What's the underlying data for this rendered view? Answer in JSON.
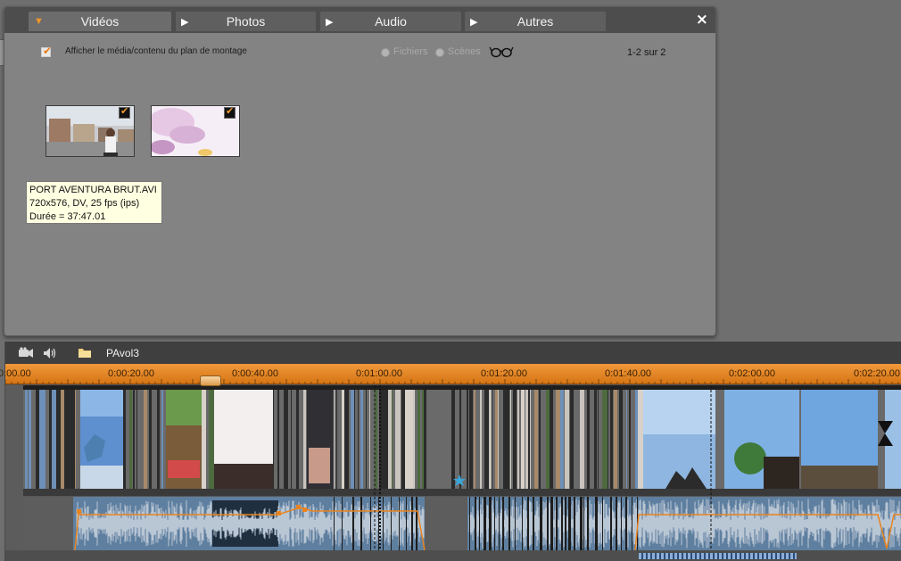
{
  "browser": {
    "tabs": [
      {
        "label": "Vidéos",
        "active": true
      },
      {
        "label": "Photos",
        "active": false
      },
      {
        "label": "Audio",
        "active": false
      },
      {
        "label": "Autres",
        "active": false
      }
    ],
    "close_icon": "×",
    "show_montage_label": "Afficher le média/contenu du plan de montage",
    "show_montage_checked": true,
    "radio_files": "Fichiers",
    "radio_scenes": "Scènes",
    "count_text": "1-2 sur 2",
    "thumbnails": [
      {
        "name": "clip-1",
        "checked": true
      },
      {
        "name": "clip-2",
        "checked": true
      }
    ],
    "tooltip": {
      "filename": "PORT AVENTURA BRUT.AVI",
      "format": "720x576, DV, 25 fps (ips)",
      "duration": "Durée = 37:47.01"
    }
  },
  "timeline": {
    "project_name": "PAvol3",
    "ruler_labels": [
      "0:00.00",
      "0:00:20.00",
      "0:00:40.00",
      "0:01:00.00",
      "0:01:20.00",
      "0:01:40.00",
      "0:02:00.00",
      "0:02:20.00"
    ],
    "icons": [
      "camera-icon",
      "speaker-icon",
      "folder-icon"
    ],
    "accent": "#e8841f"
  }
}
